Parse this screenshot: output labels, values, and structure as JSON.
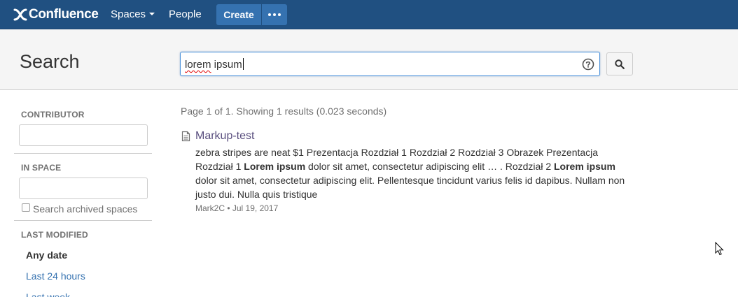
{
  "topbar": {
    "logo_text": "Confluence",
    "nav": {
      "spaces_label": "Spaces",
      "people_label": "People"
    },
    "create_label": "Create",
    "more_icon": "ellipsis-icon"
  },
  "header": {
    "title": "Search",
    "search": {
      "value_word1": "lorem",
      "value_word2": " ipsum",
      "help_icon": "help-icon",
      "submit_icon": "search-icon"
    }
  },
  "sidebar": {
    "contributor": {
      "label": "CONTRIBUTOR",
      "value": ""
    },
    "in_space": {
      "label": "IN SPACE",
      "value": "",
      "archived_label": "Search archived spaces",
      "archived_checked": false
    },
    "last_modified": {
      "label": "LAST MODIFIED",
      "options": [
        {
          "label": "Any date",
          "selected": true
        },
        {
          "label": "Last 24 hours",
          "selected": false
        },
        {
          "label": "Last week",
          "selected": false
        }
      ]
    }
  },
  "results": {
    "summary": "Page 1 of 1. Showing 1 results (0.023 seconds)",
    "items": [
      {
        "title": "Markup-test",
        "icon": "page-icon",
        "snippet_parts": [
          "zebra stripes are neat $1 Prezentacja Rozdział 1 Rozdział 2 Rozdział 3 Obrazek  Prezentacja Rozdział 1 ",
          "Lorem ipsum",
          " dolor sit amet, consectetur adipiscing elit … . Rozdział 2 ",
          "Lorem ipsum",
          " dolor sit amet, consectetur adipiscing elit. Pellentesque tincidunt varius felis id dapibus. Nullam non justo dui. Nulla quis tristique"
        ],
        "meta": "Mark2C • Jul 19, 2017"
      }
    ]
  },
  "colors": {
    "topbar_bg": "#205081",
    "button_bg": "#3572b0",
    "link": "#3572b0",
    "result_title": "#5a4f7f"
  }
}
